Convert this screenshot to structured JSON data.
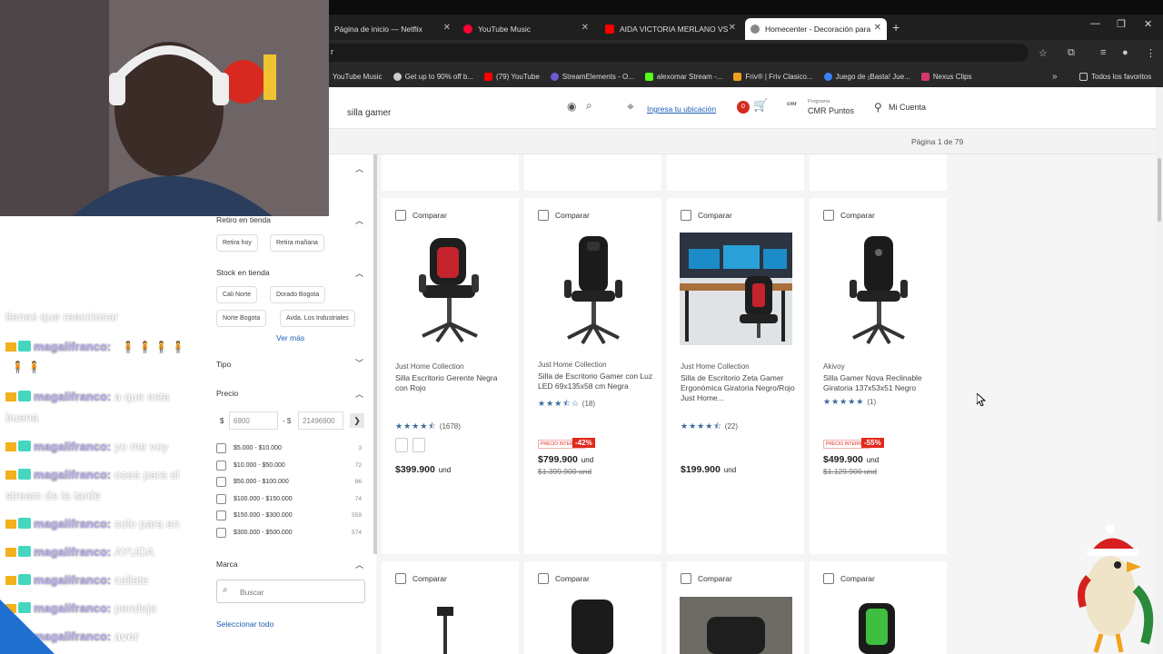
{
  "browser": {
    "tabs": [
      {
        "title": "Página de inicio — Netflix",
        "color": "#e50914"
      },
      {
        "title": "YouTube Music",
        "color": "#ff0033"
      },
      {
        "title": "AIDA VICTORIA MERLANO VS",
        "color": "#ff0000"
      },
      {
        "title": "Homecenter - Decoración para",
        "color": "#888888"
      }
    ],
    "new_tab": "+",
    "address_fragment": "r",
    "bookmarks": [
      "YouTube Music",
      "Get up to 90% off b...",
      "(79) YouTube",
      "StreamElements - O...",
      "alexomar Stream -...",
      "Friv® | Friv Clasico...",
      "Juego de ¡Basta! Jue...",
      "Nexus Clips"
    ],
    "bookmarks_more": "»",
    "all_favorites": "Todos los favoritos"
  },
  "header": {
    "search_value": "silla gamer",
    "location_link": "Ingresa tu ubicación",
    "cart_count": "0",
    "cmr_top": "Programa",
    "cmr_label": "CMR Puntos",
    "account": "Mi Cuenta"
  },
  "pagination": "Página 1 de 79",
  "filters": {
    "pickup_title": "Retiro en tienda",
    "pickup_options": [
      "Retira hoy",
      "Retira mañana"
    ],
    "stock_title": "Stock en tienda",
    "stores": [
      "Cali Norte",
      "Dorado Bogota",
      "Norte Bogota",
      "Avda. Los Industriales"
    ],
    "see_more": "Ver más",
    "type_title": "Tipo",
    "price_title": "Precio",
    "currency": "$",
    "price_min": "6900",
    "price_sep": "- $",
    "price_max": "21496900",
    "price_ranges": [
      {
        "label": "$5.000 - $10.000",
        "count": "3"
      },
      {
        "label": "$10.000 - $50.000",
        "count": "72"
      },
      {
        "label": "$50.000 - $100.000",
        "count": "86"
      },
      {
        "label": "$100.000 - $150.000",
        "count": "74"
      },
      {
        "label": "$150.000 - $300.000",
        "count": "559"
      },
      {
        "label": "$300.000 - $500.000",
        "count": "574"
      }
    ],
    "brand_title": "Marca",
    "brand_search_placeholder": "Buscar",
    "select_all": "Seleccionar todo"
  },
  "compare_label": "Comparar",
  "products": [
    {
      "brand": "Just Home Collection",
      "name": "Silla Escritorio Gerente Negra con Rojo",
      "reviews": "(1678)",
      "stars": 4.5,
      "price": "$399.900",
      "unit": "und",
      "discount": "",
      "old_price": "",
      "image": "office-chair-red"
    },
    {
      "brand": "Just Home Collection",
      "name": "Silla de Escritorio Gamer con Luz LED 69x135x58 cm Negra",
      "reviews": "(18)",
      "stars": 3.5,
      "price": "$799.900",
      "unit": "und",
      "discount": "-42%",
      "old_price": "$1.399.900",
      "old_unit": "und",
      "promo_tag": "PRECIO INTERNET",
      "image": "gamer-chair-black"
    },
    {
      "brand": "Just Home Collection",
      "name": "Silla de Escritorio Zeta Gamer Ergonómica Giratoria Negro/Rojo Just Home...",
      "reviews": "(22)",
      "stars": 4.5,
      "price": "$199.900",
      "unit": "und",
      "discount": "",
      "old_price": "",
      "image": "gaming-desk-setup"
    },
    {
      "brand": "Akivoy",
      "name": "Silla Gamer Nova Reclinable Giratoria 137x53x51 Negro",
      "reviews": "(1)",
      "stars": 5,
      "price": "$499.900",
      "unit": "und",
      "discount": "-55%",
      "old_price": "$1.129.900",
      "old_unit": "und",
      "promo_tag": "PRECIO INTERNET",
      "image": "gamer-chair-black"
    }
  ],
  "chat": [
    {
      "user": "",
      "text": "tienes que reaccionar"
    },
    {
      "user": "magalifranco:",
      "text": ""
    },
    {
      "user": "magalifranco:",
      "text": "a que esta"
    },
    {
      "user": "",
      "text": "buena"
    },
    {
      "user": "magalifranco:",
      "text": "yo me voy"
    },
    {
      "user": "magalifranco:",
      "text": "osea para el"
    },
    {
      "user": "",
      "text": "stream de la tarde"
    },
    {
      "user": "magalifranco:",
      "text": "solo para en"
    },
    {
      "user": "magalifranco:",
      "text": "AYUDA"
    },
    {
      "user": "magalifranco:",
      "text": "callate"
    },
    {
      "user": "magalifranco:",
      "text": "pendejo"
    },
    {
      "user": "magalifranco:",
      "text": "aver"
    }
  ]
}
